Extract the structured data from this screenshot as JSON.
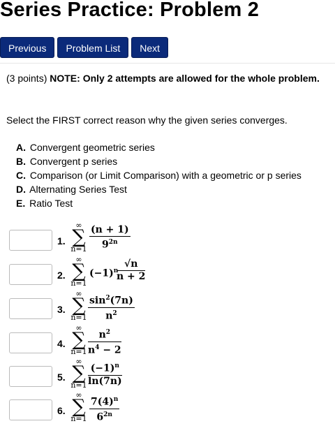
{
  "page_title": "Series Practice: Problem 2",
  "nav": {
    "previous": "Previous",
    "problem_list": "Problem List",
    "next": "Next"
  },
  "note": {
    "points": "(3 points)",
    "text": "NOTE: Only 2 attempts are allowed for the whole problem."
  },
  "question": "Select the FIRST correct reason why the given series converges.",
  "options": [
    {
      "letter": "A.",
      "text": "Convergent geometric series"
    },
    {
      "letter": "B.",
      "text": "Convergent p series"
    },
    {
      "letter": "C.",
      "text": "Comparison (or Limit Comparison) with a geometric or p series"
    },
    {
      "letter": "D.",
      "text": "Alternating Series Test"
    },
    {
      "letter": "E.",
      "text": "Ratio Test"
    }
  ],
  "sum_limits": {
    "upper": "∞",
    "lower": "n=1",
    "symbol": "∑"
  },
  "problems": [
    {
      "number": "1.",
      "answer": "",
      "prefix": "",
      "numerator": "(n + 1)",
      "denominator": "9",
      "denominator_sup": "2n"
    },
    {
      "number": "2.",
      "answer": "",
      "prefix": "(−1)",
      "prefix_sup": "n",
      "numerator": "√n",
      "denominator": "n + 2"
    },
    {
      "number": "3.",
      "answer": "",
      "prefix": "",
      "numerator": "sin",
      "numerator_sup": "2",
      "numerator_rest": "(7n)",
      "denominator": "n",
      "denominator_sup": "2"
    },
    {
      "number": "4.",
      "answer": "",
      "prefix": "",
      "numerator": "n",
      "numerator_sup": "2",
      "denominator": "n",
      "denominator_sup": "4",
      "denominator_rest": " − 2"
    },
    {
      "number": "5.",
      "answer": "",
      "prefix": "",
      "numerator": "(−1)",
      "numerator_sup": "n",
      "denominator": "ln(7n)"
    },
    {
      "number": "6.",
      "answer": "",
      "prefix": "",
      "numerator": "7(4)",
      "numerator_sup": "n",
      "denominator": "6",
      "denominator_sup": "2n"
    }
  ]
}
